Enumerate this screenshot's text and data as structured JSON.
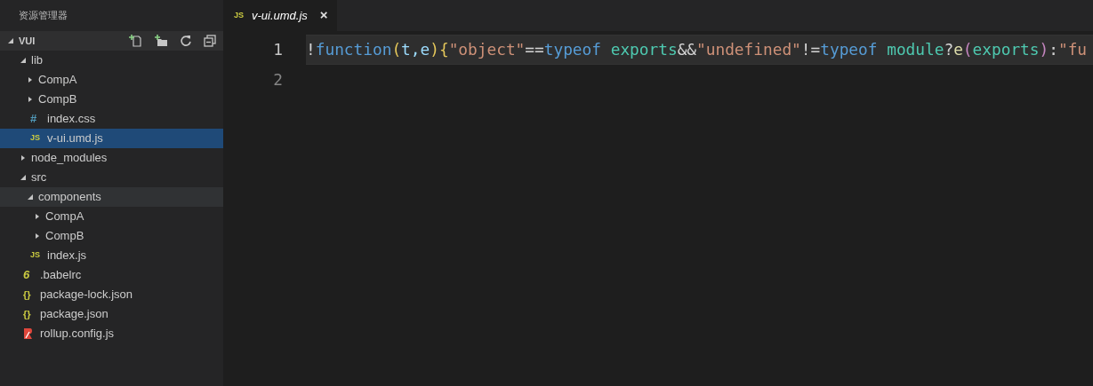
{
  "explorer": {
    "title": "资源管理器",
    "section": {
      "label": "VUI",
      "expanded": true
    },
    "tree": [
      {
        "label": "lib",
        "kind": "folder",
        "expanded": true,
        "selected": false,
        "hovered": false,
        "children": [
          {
            "label": "CompA",
            "kind": "folder",
            "expanded": false,
            "selected": false,
            "hovered": false
          },
          {
            "label": "CompB",
            "kind": "folder",
            "expanded": false,
            "selected": false,
            "hovered": false
          },
          {
            "label": "index.css",
            "kind": "css",
            "icon": "#",
            "selected": false,
            "hovered": false
          },
          {
            "label": "v-ui.umd.js",
            "kind": "js",
            "icon": "JS",
            "selected": true,
            "hovered": false
          }
        ]
      },
      {
        "label": "node_modules",
        "kind": "folder",
        "expanded": false,
        "selected": false,
        "hovered": false
      },
      {
        "label": "src",
        "kind": "folder",
        "expanded": true,
        "selected": false,
        "hovered": false,
        "children": [
          {
            "label": "components",
            "kind": "folder",
            "expanded": true,
            "selected": false,
            "hovered": true,
            "children": [
              {
                "label": "CompA",
                "kind": "folder",
                "expanded": false,
                "selected": false,
                "hovered": false
              },
              {
                "label": "CompB",
                "kind": "folder",
                "expanded": false,
                "selected": false,
                "hovered": false
              }
            ]
          },
          {
            "label": "index.js",
            "kind": "js",
            "icon": "JS",
            "selected": false,
            "hovered": false
          }
        ]
      },
      {
        "label": ".babelrc",
        "kind": "babel",
        "icon": "6",
        "selected": false,
        "hovered": false
      },
      {
        "label": "package-lock.json",
        "kind": "json",
        "icon": "{}",
        "selected": false,
        "hovered": false
      },
      {
        "label": "package.json",
        "kind": "json",
        "icon": "{}",
        "selected": false,
        "hovered": false
      },
      {
        "label": "rollup.config.js",
        "kind": "rollup",
        "selected": false,
        "hovered": false
      }
    ]
  },
  "tabs": [
    {
      "label": "v-ui.umd.js",
      "kind": "js",
      "icon": "JS",
      "close": "×",
      "selected": true
    }
  ],
  "editor": {
    "lines": [
      {
        "number": "1",
        "current": true,
        "tokens": [
          {
            "text": "!",
            "kind": "plain"
          },
          {
            "text": "function",
            "kind": "keyword"
          },
          {
            "text": "(",
            "kind": "bracket"
          },
          {
            "text": "t,e",
            "kind": "variable"
          },
          {
            "text": ")",
            "kind": "bracket"
          },
          {
            "text": "{",
            "kind": "bracket"
          },
          {
            "text": "\"object\"",
            "kind": "string"
          },
          {
            "text": "==",
            "kind": "plain"
          },
          {
            "text": "typeof",
            "kind": "keyword"
          },
          {
            "text": " exports",
            "kind": "identifier"
          },
          {
            "text": "&&",
            "kind": "plain"
          },
          {
            "text": "\"undefined\"",
            "kind": "string"
          },
          {
            "text": "!=",
            "kind": "plain"
          },
          {
            "text": "typeof",
            "kind": "keyword"
          },
          {
            "text": " module",
            "kind": "identifier"
          },
          {
            "text": "?",
            "kind": "plain"
          },
          {
            "text": "e",
            "kind": "call"
          },
          {
            "text": "(",
            "kind": "bracket2"
          },
          {
            "text": "exports",
            "kind": "identifier"
          },
          {
            "text": ")",
            "kind": "bracket2"
          },
          {
            "text": ":",
            "kind": "plain"
          },
          {
            "text": "\"fu",
            "kind": "string"
          }
        ]
      },
      {
        "number": "2",
        "current": false
      }
    ]
  }
}
